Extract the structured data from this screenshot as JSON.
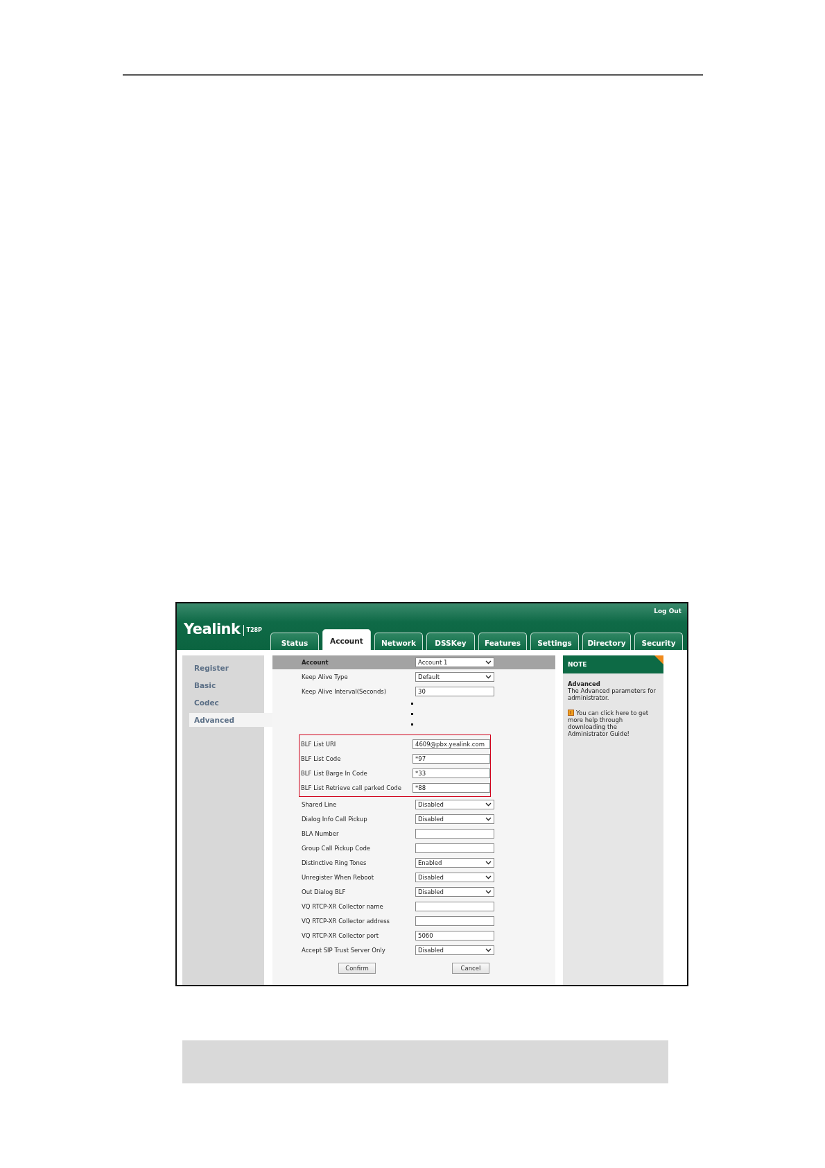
{
  "header": {
    "logo": "Yealink",
    "model": "T28P",
    "logout": "Log Out"
  },
  "tabs": [
    {
      "label": "Status",
      "selected": false
    },
    {
      "label": "Account",
      "selected": true
    },
    {
      "label": "Network",
      "selected": false
    },
    {
      "label": "DSSKey",
      "selected": false
    },
    {
      "label": "Features",
      "selected": false
    },
    {
      "label": "Settings",
      "selected": false
    },
    {
      "label": "Directory",
      "selected": false
    },
    {
      "label": "Security",
      "selected": false
    }
  ],
  "sidebar": {
    "items": [
      {
        "label": "Register",
        "selected": false
      },
      {
        "label": "Basic",
        "selected": false
      },
      {
        "label": "Codec",
        "selected": false
      },
      {
        "label": "Advanced",
        "selected": true
      }
    ]
  },
  "form": {
    "header": {
      "label": "Account",
      "value": "Account 1"
    },
    "rows_top": [
      {
        "kind": "select",
        "label": "Keep Alive Type",
        "value": "Default"
      },
      {
        "kind": "input",
        "label": "Keep Alive Interval(Seconds)",
        "value": "30"
      }
    ],
    "highlighted_rows": [
      {
        "kind": "input",
        "label": "BLF List URI",
        "value": "4609@pbx.yealink.com"
      },
      {
        "kind": "input",
        "label": "BLF List Code",
        "value": "*97"
      },
      {
        "kind": "input",
        "label": "BLF List Barge In Code",
        "value": "*33"
      },
      {
        "kind": "input",
        "label": "BLF List Retrieve call parked Code",
        "value": "*88"
      }
    ],
    "rows_bottom": [
      {
        "kind": "select",
        "label": "Shared Line",
        "value": "Disabled"
      },
      {
        "kind": "select",
        "label": "Dialog Info Call Pickup",
        "value": "Disabled"
      },
      {
        "kind": "input",
        "label": "BLA Number"
      },
      {
        "kind": "input",
        "label": "Group Call Pickup Code"
      },
      {
        "kind": "select",
        "label": "Distinctive Ring Tones",
        "value": "Enabled"
      },
      {
        "kind": "select",
        "label": "Unregister When Reboot",
        "value": "Disabled"
      },
      {
        "kind": "select",
        "label": "Out Dialog BLF",
        "value": "Disabled"
      },
      {
        "kind": "input",
        "label": "VQ RTCP-XR Collector name"
      },
      {
        "kind": "input",
        "label": "VQ RTCP-XR Collector address"
      },
      {
        "kind": "input",
        "label": "VQ RTCP-XR Collector port",
        "value": "5060"
      },
      {
        "kind": "select",
        "label": "Accept SIP Trust Server Only",
        "value": "Disabled"
      }
    ],
    "buttons": [
      "Confirm",
      "Cancel"
    ]
  },
  "note": {
    "title": "NOTE",
    "heading": "Advanced",
    "text": "The Advanced parameters for administrator.",
    "help": "You can click here to get more help through downloading the Administrator Guide!"
  }
}
